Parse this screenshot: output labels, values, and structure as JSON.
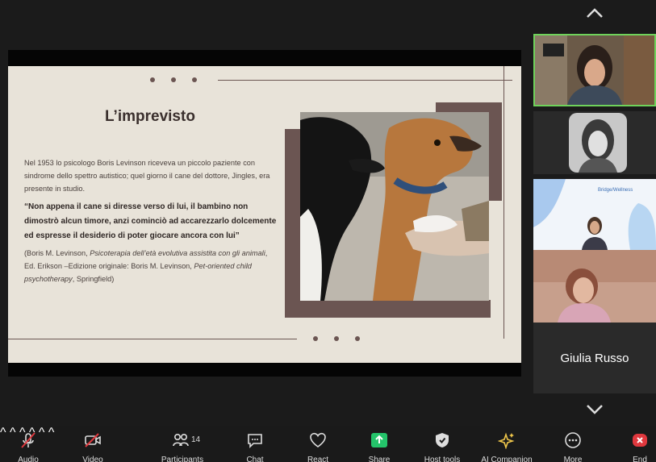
{
  "slide": {
    "title": "L’imprevisto",
    "para1": "Nel 1953 lo psicologo Boris Levinson riceveva un piccolo paziente con sindrome dello spettro autistico; quel giorno il cane del dottore, Jingles, era presente in studio.",
    "quote": "“Non appena il cane si diresse verso di lui, il bambino non dimostrò alcun timore, anzi cominciò ad accarezzarlo dolcemente ed espresse il desiderio di poter giocare ancora con lui”",
    "citation_a": "(Boris M. Levinson, ",
    "citation_book1": "Psicoterapia dell’età evolutiva assistita con gli animali",
    "citation_b": ", Ed. Erikson –Edizione originale: Boris M. Levinson, ",
    "citation_book2": "Pet-oriented child psychotherapy",
    "citation_c": ", Springfield)",
    "photo_desc": "dogs-photo"
  },
  "gallery": {
    "name_tile_label": "Giulia Russo",
    "slide_tile_text": "Bridge/Wellness"
  },
  "toolbar": {
    "audio": "Audio",
    "video": "Video",
    "participants": "Participants",
    "participants_count": "14",
    "chat": "Chat",
    "react": "React",
    "share": "Share",
    "host_tools": "Host tools",
    "ai_companion": "AI Companion",
    "more": "More",
    "end": "End"
  },
  "colors": {
    "accent_green": "#6fd35b",
    "share_green": "#24c46a",
    "end_red": "#e0383e",
    "ai_yellow": "#f1c84b",
    "slide_bg": "#e8e3d9",
    "slide_brown": "#6b5552"
  }
}
